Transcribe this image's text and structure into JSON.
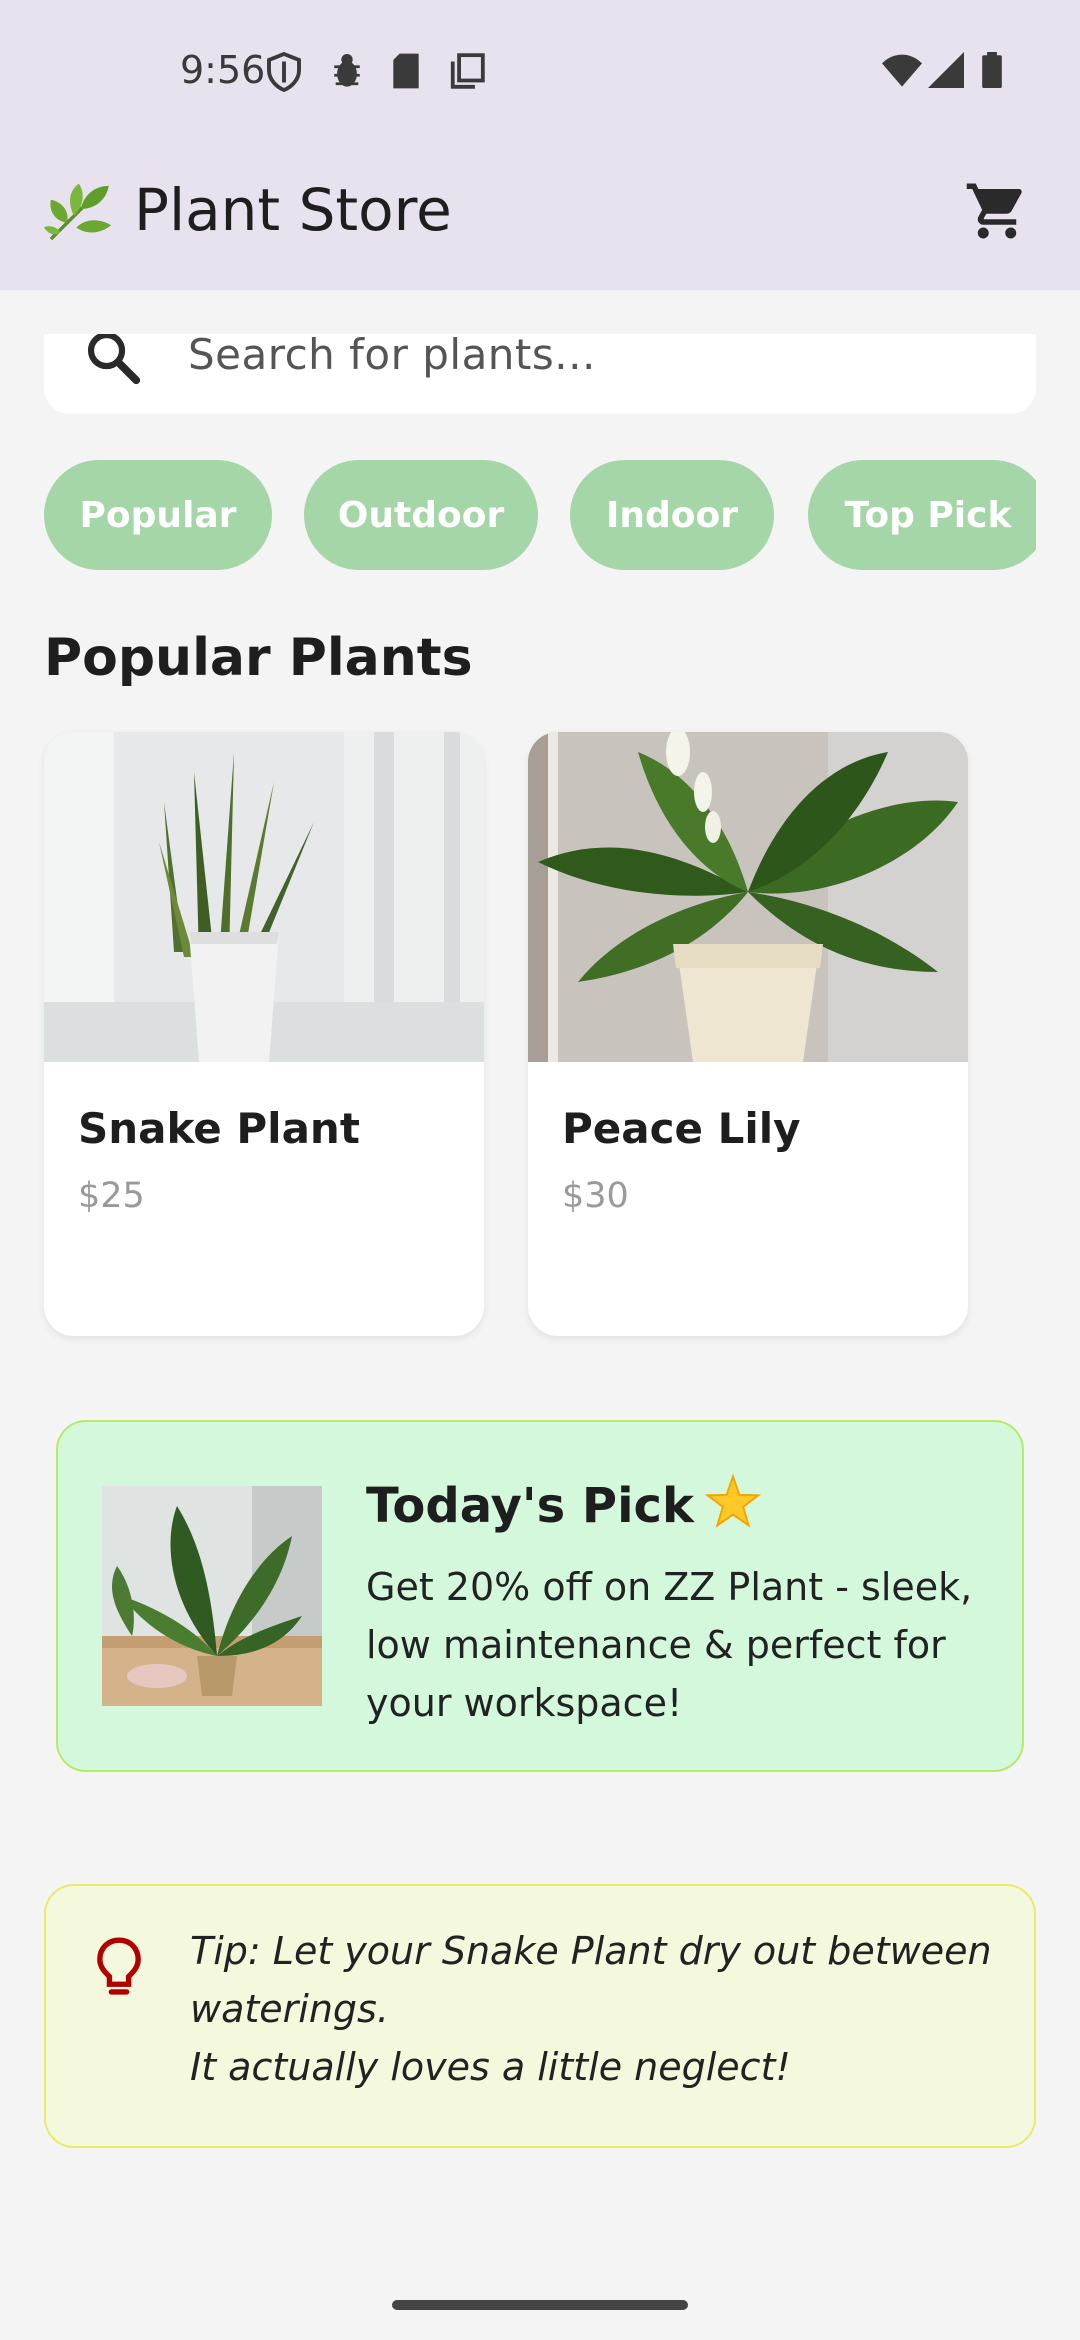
{
  "status_bar": {
    "time": "9:56",
    "icons": [
      "shield-icon",
      "bug-icon",
      "sd-card-icon",
      "copy-icon",
      "wifi-icon",
      "signal-icon",
      "battery-icon"
    ]
  },
  "app_bar": {
    "logo": "🌿",
    "title": "Plant Store",
    "cart_icon": "cart-icon"
  },
  "search": {
    "placeholder": "Search for plants..."
  },
  "categories": [
    "Popular",
    "Outdoor",
    "Indoor",
    "Top Pick"
  ],
  "section_title": "Popular Plants",
  "products": [
    {
      "name": "Snake Plant",
      "price": "$25"
    },
    {
      "name": "Peace Lily",
      "price": "$30"
    }
  ],
  "promo": {
    "title": "Today's Pick",
    "star": "🌟",
    "text": "Get 20% off on ZZ Plant - sleek, low maintenance & perfect for your workspace!"
  },
  "tip": {
    "line1": "Tip: Let your Snake Plant dry out between waterings.",
    "line2": "It actually loves a little neglect!"
  },
  "colors": {
    "app_bar_bg": "#e8e2ee",
    "chip_bg": "#a5d6a7",
    "promo_bg": "#d4f8dc",
    "tip_bg": "#f4f9dd",
    "tip_icon": "#b00000"
  }
}
